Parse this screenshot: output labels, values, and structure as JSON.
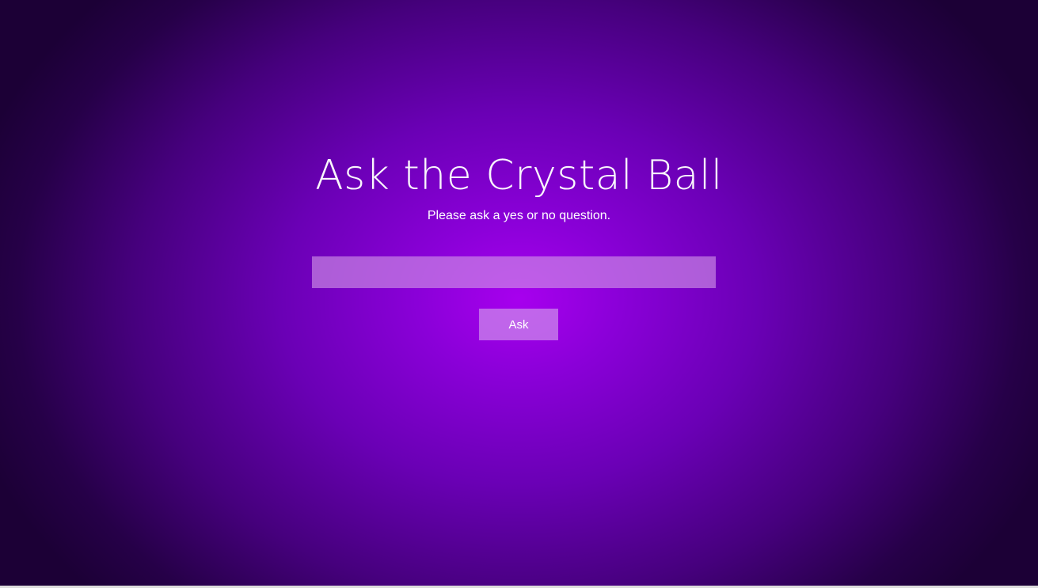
{
  "page": {
    "title": "Ask the Crystal Ball",
    "subtitle": "Please ask a yes or no question."
  },
  "form": {
    "question_value": "",
    "question_placeholder": "",
    "ask_label": "Ask"
  },
  "colors": {
    "background_center": "#a700ee",
    "background_edge": "#1c0036",
    "text": "#ffffff"
  }
}
